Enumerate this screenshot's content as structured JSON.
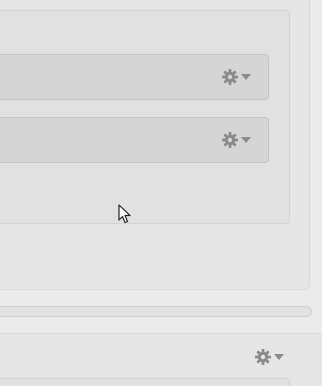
{
  "icons": {
    "gear": "gear-icon",
    "dropdown": "caret-down-icon",
    "cursor": "mouse-pointer-icon"
  },
  "colors": {
    "gear": "#8a8a8a",
    "caret": "#8a8a8a",
    "background": "#ebebeb",
    "panel": "#e6e6e6",
    "bar": "#d5d5d5"
  }
}
